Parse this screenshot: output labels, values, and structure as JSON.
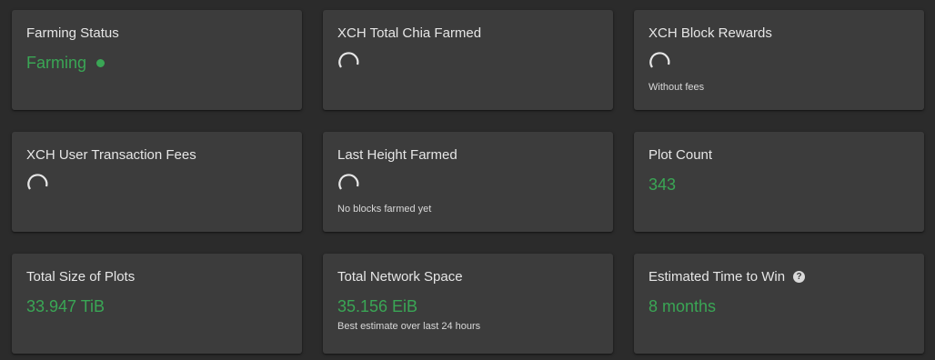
{
  "colors": {
    "background": "#2b2b2b",
    "card": "#3c3c3c",
    "accent_green": "#3aa655",
    "text": "#e6e6e6"
  },
  "cards": {
    "farming_status": {
      "title": "Farming Status",
      "value": "Farming",
      "indicator": "green-dot"
    },
    "total_chia_farmed": {
      "title": "XCH Total Chia Farmed",
      "state": "loading"
    },
    "block_rewards": {
      "title": "XCH Block Rewards",
      "state": "loading",
      "caption": "Without fees"
    },
    "user_transaction_fees": {
      "title": "XCH User Transaction Fees",
      "state": "loading"
    },
    "last_height_farmed": {
      "title": "Last Height Farmed",
      "state": "loading",
      "caption": "No blocks farmed yet"
    },
    "plot_count": {
      "title": "Plot Count",
      "value": "343"
    },
    "total_size_of_plots": {
      "title": "Total Size of Plots",
      "value": "33.947 TiB"
    },
    "total_network_space": {
      "title": "Total Network Space",
      "value": "35.156 EiB",
      "caption": "Best estimate over last 24 hours"
    },
    "estimated_time_to_win": {
      "title": "Estimated Time to Win",
      "value": "8 months",
      "help_icon": "help-circle-icon",
      "help_glyph": "?"
    }
  }
}
